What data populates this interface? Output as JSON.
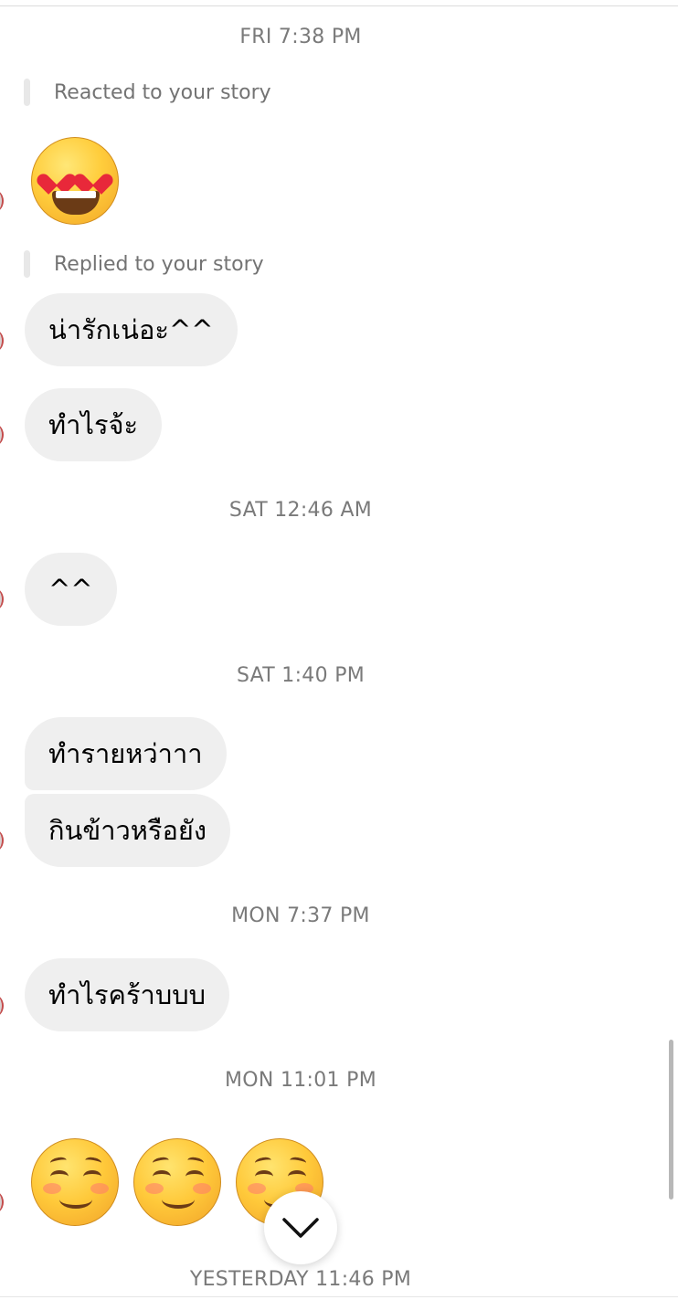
{
  "thread": {
    "timestamps": {
      "fri": "FRI 7:38 PM",
      "sat_am": "SAT 12:46 AM",
      "sat_pm": "SAT 1:40 PM",
      "mon_pm": "MON 7:37 PM",
      "mon_late": "MON 11:01 PM",
      "yesterday": "YESTERDAY 11:46 PM"
    },
    "story_notes": {
      "reacted": "Reacted to your story",
      "replied": "Replied to your story"
    },
    "messages": {
      "m1": "น่ารักเน่อะ^^",
      "m2": "ทำไรจ้ะ",
      "m3": "^^",
      "m4": "ทำรายหว่าาา",
      "m5": "กินข้าวหรือยัง",
      "m6": "ทำไรคร้าบบบ"
    },
    "reactions": {
      "story_reaction_icon": "heart-eyes-emoji",
      "smile_icon": "smiling-face-emoji"
    }
  },
  "controls": {
    "scroll_down_icon": "chevron-down-icon"
  },
  "colors": {
    "bubble": "#efefef",
    "timestamp": "#7a7a7a",
    "background": "#ffffff"
  }
}
